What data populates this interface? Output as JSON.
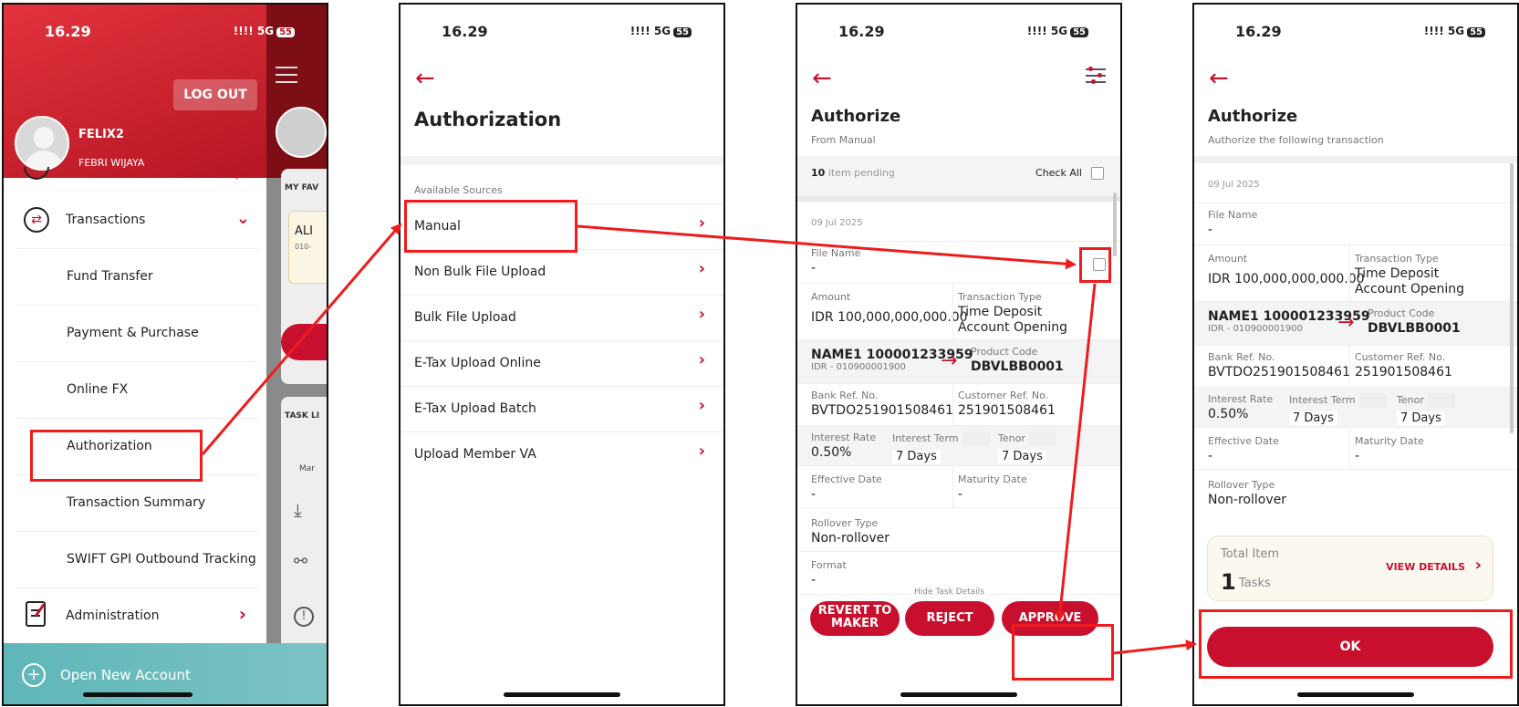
{
  "status": {
    "time": "16.29",
    "signal": "!!!! 5G",
    "battery": "55"
  },
  "screen1": {
    "logout_label": "LOG OUT",
    "user_name": "FELIX2",
    "user_fullname": "FEBRI WIJAYA",
    "menu_transactions": "Transactions",
    "submenu": [
      "Fund Transfer",
      "Payment & Purchase",
      "Online FX",
      "Authorization",
      "Transaction Summary",
      "SWIFT GPI Outbound Tracking"
    ],
    "menu_administration": "Administration",
    "open_account": "Open New Account",
    "side_labels": {
      "favorites": "MY FAV",
      "card_title": "ALI",
      "card_sub": "010-",
      "task": "TASK LI",
      "task_item": "Mar"
    }
  },
  "screen2": {
    "title": "Authorization",
    "section_label": "Available Sources",
    "sources": [
      "Manual",
      "Non Bulk File Upload",
      "Bulk File Upload",
      "E-Tax Upload Online",
      "E-Tax Upload Batch",
      "Upload Member VA"
    ]
  },
  "screen3": {
    "title": "Authorize",
    "subtitle": "From Manual",
    "pending_count": "10",
    "pending_label": "item pending",
    "check_all": "Check All",
    "date": "09 Jul 2025",
    "file_name_label": "File Name",
    "file_name_value": "-",
    "amount_label": "Amount",
    "amount_value": "IDR 100,000,000,000.00",
    "trx_type_label": "Transaction Type",
    "trx_type_value": "Time Deposit Account Opening",
    "account_name": "NAME1 100001233959",
    "account_sub": "IDR - 010900001900",
    "product_code_label": "Product Code",
    "product_code_value": "DBVLBB0001",
    "bank_ref_label": "Bank Ref. No.",
    "bank_ref_value": "BVTDO251901508461",
    "cust_ref_label": "Customer Ref. No.",
    "cust_ref_value": "251901508461",
    "interest_rate_label": "Interest Rate",
    "interest_rate_value": "0.50%",
    "interest_term_label": "Interest Term",
    "interest_term_value": "7 Days",
    "tenor_label": "Tenor",
    "tenor_value": "7 Days",
    "effective_label": "Effective Date",
    "effective_value": "-",
    "maturity_label": "Maturity Date",
    "maturity_value": "-",
    "rollover_label": "Rollover Type",
    "rollover_value": "Non-rollover",
    "format_label": "Format",
    "format_value": "-",
    "hide_details": "Hide Task Details",
    "btn_revert": "REVERT TO MAKER",
    "btn_reject": "REJECT",
    "btn_approve": "APPROVE"
  },
  "screen4": {
    "title": "Authorize",
    "subtitle": "Authorize the following transaction",
    "date": "09 Jul 2025",
    "file_name_label": "File Name",
    "file_name_value": "-",
    "amount_label": "Amount",
    "amount_value": "IDR 100,000,000,000.00",
    "trx_type_label": "Transaction Type",
    "trx_type_value": "Time Deposit Account Opening",
    "account_name": "NAME1 100001233959",
    "account_sub": "IDR - 010900001900",
    "product_code_label": "Product Code",
    "product_code_value": "DBVLBB0001",
    "bank_ref_label": "Bank Ref. No.",
    "bank_ref_value": "BVTDO251901508461",
    "cust_ref_label": "Customer Ref. No.",
    "cust_ref_value": "251901508461",
    "interest_rate_label": "Interest Rate",
    "interest_rate_value": "0.50%",
    "interest_term_label": "Interest Term",
    "interest_term_value": "7 Days",
    "tenor_label": "Tenor",
    "tenor_value": "7 Days",
    "effective_label": "Effective Date",
    "effective_value": "-",
    "maturity_label": "Maturity Date",
    "maturity_value": "-",
    "rollover_label": "Rollover Type",
    "rollover_value": "Non-rollover",
    "total_item_label": "Total Item",
    "total_count": "1",
    "total_unit": "Tasks",
    "view_details": "VIEW DETAILS",
    "btn_ok": "OK"
  },
  "icons": [
    "back-arrow-icon",
    "chevron-right-icon",
    "chevron-down-icon",
    "transfer-icon",
    "clipboard-icon",
    "filter-icon",
    "hamburger-icon",
    "plus-circle-icon"
  ],
  "colors": {
    "brand_red": "#c8102e",
    "highlight": "#ee1c1c",
    "teal": "#6bbcbd"
  }
}
